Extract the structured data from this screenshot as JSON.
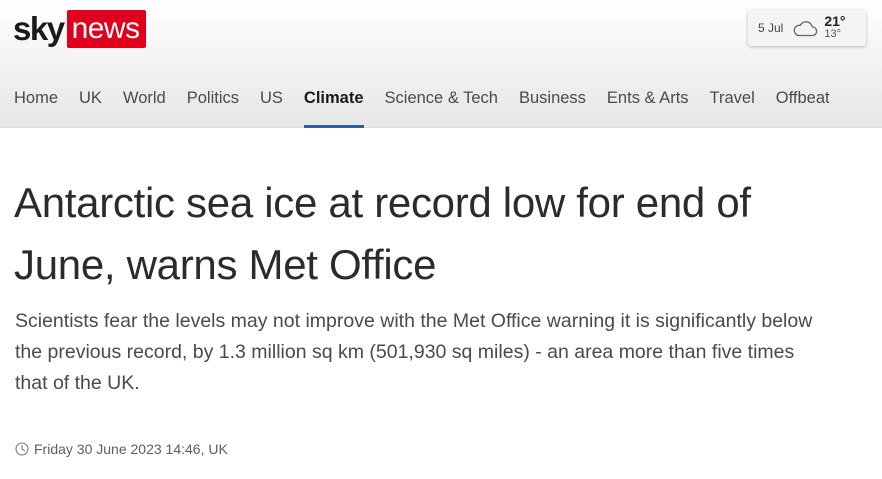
{
  "brand": {
    "logo_part1": "sky",
    "logo_part2": "news",
    "accent_color": "#e0001b"
  },
  "weather": {
    "date": "5 Jul",
    "icon": "cloud-icon",
    "high": "21°",
    "low": "13°"
  },
  "nav": {
    "items": [
      {
        "label": "Home"
      },
      {
        "label": "UK"
      },
      {
        "label": "World"
      },
      {
        "label": "Politics"
      },
      {
        "label": "US"
      },
      {
        "label": "Climate",
        "active": true
      },
      {
        "label": "Science & Tech"
      },
      {
        "label": "Business"
      },
      {
        "label": "Ents & Arts"
      },
      {
        "label": "Travel"
      },
      {
        "label": "Offbeat"
      }
    ],
    "active_underline_color": "#2d5fa0"
  },
  "article": {
    "headline": "Antarctic sea ice at record low for end of June, warns Met Office",
    "standfirst": "Scientists fear the levels may not improve with the Met Office warning it is significantly below the previous record, by 1.3 million sq km (501,930 sq miles) - an area more than five times that of the UK.",
    "timestamp": "Friday 30 June 2023 14:46, UK",
    "timestamp_icon": "clock-icon"
  }
}
